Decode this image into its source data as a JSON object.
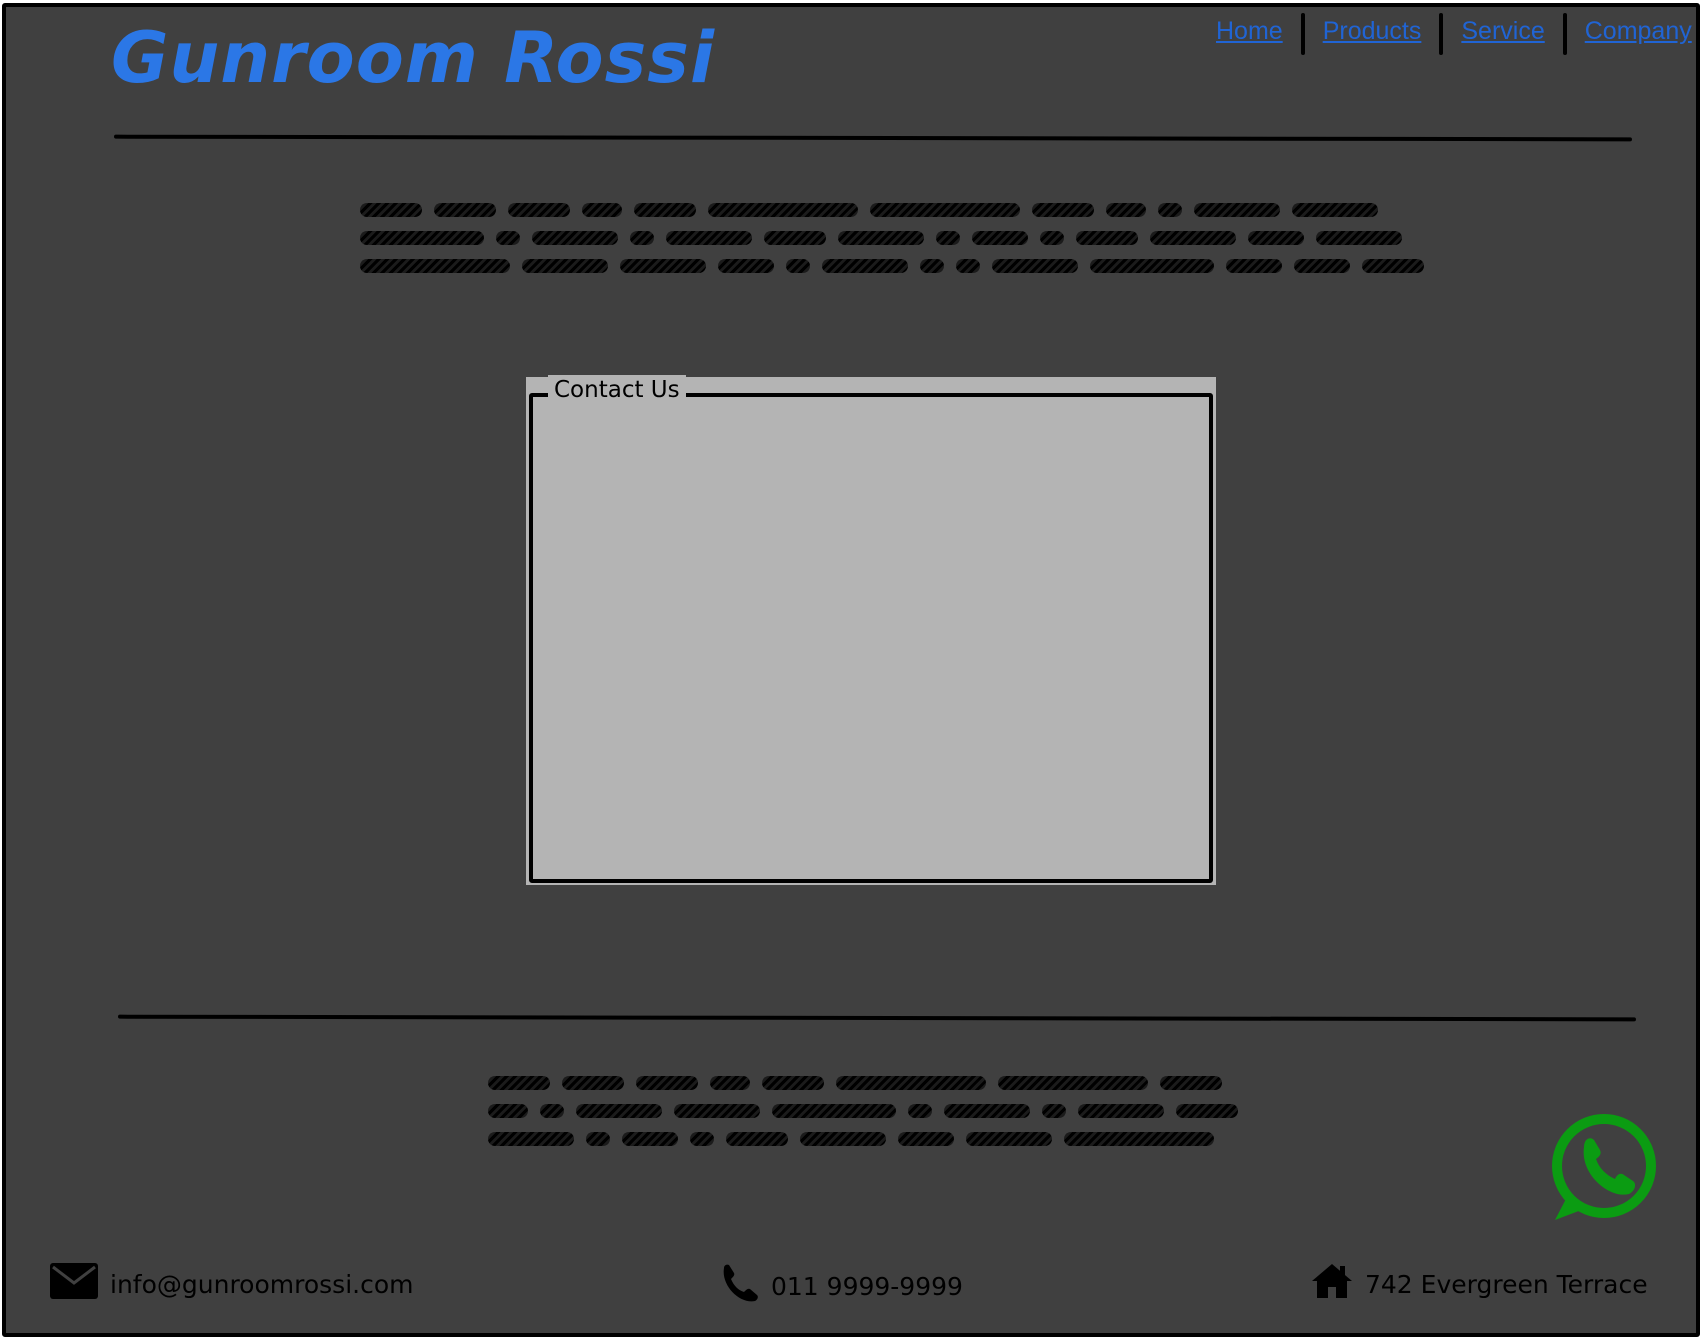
{
  "header": {
    "logo": "Gunroom Rossi",
    "nav": [
      {
        "label": "Home"
      },
      {
        "label": "Products"
      },
      {
        "label": "Service"
      },
      {
        "label": "Company"
      }
    ]
  },
  "contact": {
    "legend": "Contact Us"
  },
  "footer": {
    "email": "info@gunroomrossi.com",
    "phone": "011 9999-9999",
    "address": "742 Evergreen Terrace"
  },
  "icons": {
    "email": "envelope-icon",
    "phone": "phone-icon",
    "address": "home-icon",
    "whatsapp": "whatsapp-icon"
  },
  "colors": {
    "background": "#404040",
    "logo": "#2b77e6",
    "link": "#2064d4",
    "contact_panel": "#b4b4b4",
    "whatsapp": "#0b9c12"
  }
}
